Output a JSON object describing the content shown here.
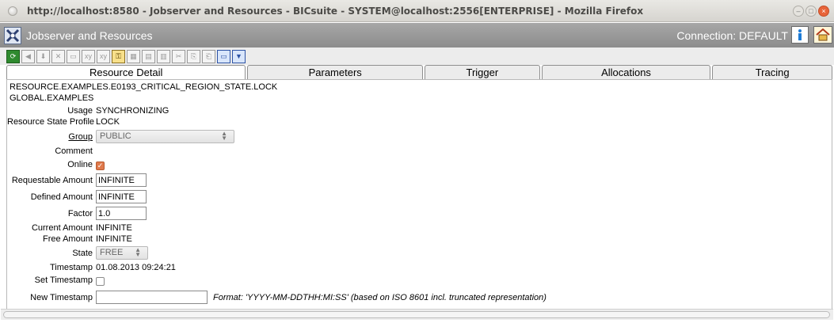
{
  "window": {
    "title": "http://localhost:8580 - Jobserver and Resources - BICsuite - SYSTEM@localhost:2556[ENTERPRISE] - Mozilla Firefox"
  },
  "app": {
    "title": "Jobserver and Resources",
    "connection": "Connection: DEFAULT"
  },
  "toolbar": {
    "buttons": [
      "refresh",
      "back",
      "save",
      "close",
      "new",
      "copy-xy",
      "copy-xxy",
      "key",
      "grid",
      "grid-alt",
      "grid-split",
      "cut",
      "copy",
      "paste",
      "comment",
      "down"
    ]
  },
  "tabs": {
    "resource_detail": "Resource Detail",
    "parameters": "Parameters",
    "trigger": "Trigger",
    "allocations": "Allocations",
    "tracing": "Tracing"
  },
  "detail": {
    "resource_path": "RESOURCE.EXAMPLES.E0193_CRITICAL_REGION_STATE.LOCK",
    "scope": "GLOBAL.EXAMPLES",
    "usage_label": "Usage",
    "usage_value": "SYNCHRONIZING",
    "rsp_label": "Resource State Profile",
    "rsp_value": "LOCK",
    "group_label": "Group",
    "group_value": "PUBLIC",
    "comment_label": "Comment",
    "online_label": "Online",
    "online_checked": true,
    "requestable_label": "Requestable Amount",
    "requestable_value": "INFINITE",
    "defined_label": "Defined Amount",
    "defined_value": "INFINITE",
    "factor_label": "Factor",
    "factor_value": "1.0",
    "current_label": "Current Amount",
    "current_value": "INFINITE",
    "free_label": "Free Amount",
    "free_value": "INFINITE",
    "state_label": "State",
    "state_value": "FREE",
    "timestamp_label": "Timestamp",
    "timestamp_value": "01.08.2013 09:24:21",
    "set_timestamp_label": "Set Timestamp",
    "set_timestamp_checked": false,
    "new_timestamp_label": "New Timestamp",
    "new_timestamp_value": "",
    "format_hint": "Format: 'YYYY-MM-DDTHH:MI:SS' (based on ISO 8601 incl. truncated representation)"
  },
  "colors": {
    "app_header": "#999999",
    "online_check": "#e07a4c"
  }
}
